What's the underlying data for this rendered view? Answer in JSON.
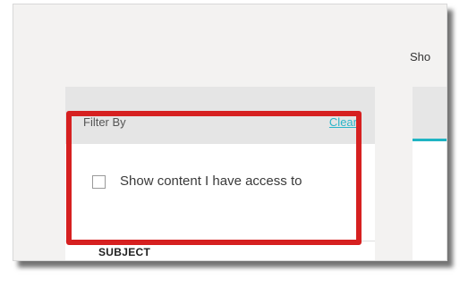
{
  "header": {
    "show_label": "Sho"
  },
  "filter": {
    "title": "Filter By",
    "clear_label": "Clear",
    "access_option_label": "Show content I have access to",
    "access_option_checked": false,
    "subject_heading": "SUBJECT"
  },
  "colors": {
    "highlight": "#d62020",
    "accent": "#2ab5c9",
    "tab_underline": "#1fb4c3"
  }
}
